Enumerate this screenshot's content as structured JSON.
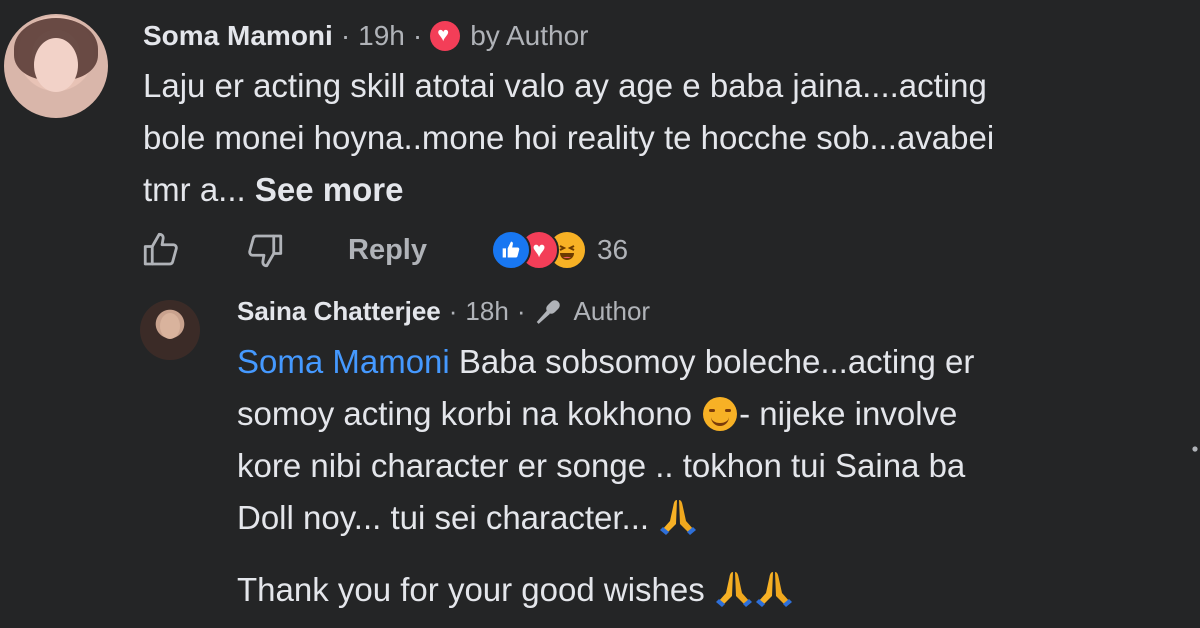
{
  "comment": {
    "author": "Soma Mamoni",
    "separator": "·",
    "time": "19h",
    "badge_text": "by Author",
    "text_lines": [
      "Laju er acting skill atotai valo ay age e baba jaina....acting",
      "bole monei hoyna..mone hoi reality te hocche sob...avabei",
      "tmr a..."
    ],
    "see_more": "See more",
    "reply_label": "Reply",
    "reaction_count": "36",
    "reactions": [
      "like-icon",
      "love-icon",
      "haha-icon"
    ]
  },
  "reply": {
    "author": "Saina Chatterjee",
    "separator": "·",
    "time": "18h",
    "role": "Author",
    "mention": "Soma Mamoni",
    "line1_rest": " Baba sobsomoy boleche...acting er",
    "line2_a": "somoy acting korbi na kokhono ",
    "line2_b": "- nijeke involve",
    "line3": "kore nibi character er songe .. tokhon tui Saina ba",
    "line4": "Doll noy... tui sei character... ",
    "line5": "Thank you for your good wishes "
  },
  "colors": {
    "background": "#242526",
    "text": "#e4e6eb",
    "secondary": "#b0b3b8",
    "mention": "#4599ff",
    "like": "#1877f2",
    "love": "#f33e58",
    "haha": "#f7b125"
  }
}
